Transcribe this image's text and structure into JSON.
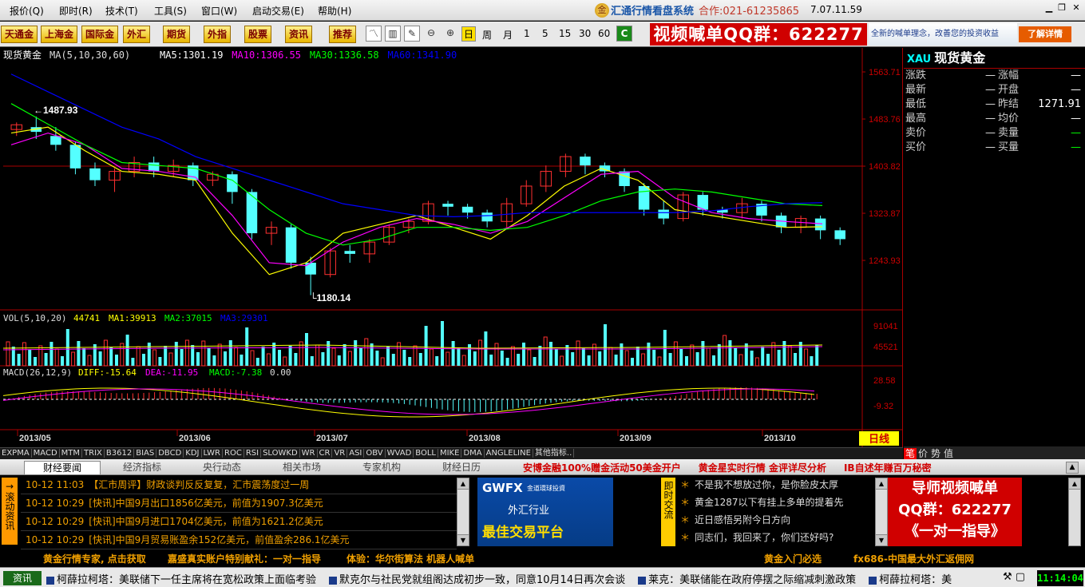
{
  "menu": {
    "items": [
      "报价(Q)",
      "即时(R)",
      "技术(T)",
      "工具(S)",
      "窗口(W)",
      "启动交易(E)",
      "帮助(H)"
    ],
    "app_name": "汇通行情看盘系统",
    "contact": "合作:021-61235865",
    "version": "7.07.11.59",
    "logo_char": "金"
  },
  "toolbar": {
    "market_buttons": [
      "天通金",
      "上海金",
      "国际金",
      "外汇",
      "期货",
      "外指",
      "股票",
      "资讯",
      "推荐"
    ],
    "periods": [
      "日",
      "周",
      "月",
      "1",
      "5",
      "15",
      "30",
      "60"
    ],
    "active_period": "日",
    "ad_banner": "视频喊单QQ群：622277",
    "ad_text": "全新的喊单理念，改善您的投资收益",
    "ad_button": "了解详情"
  },
  "main_chart": {
    "instrument": "现货黄金",
    "ma_label": "MA(5,10,30,60)",
    "ma_values": [
      {
        "name": "MA5",
        "value": "1301.19",
        "color": "#ffffff"
      },
      {
        "name": "MA10",
        "value": "1306.55",
        "color": "#ff00ff"
      },
      {
        "name": "MA30",
        "value": "1336.58",
        "color": "#00ff00"
      },
      {
        "name": "MA60",
        "value": "1341.90",
        "color": "#0000ff"
      }
    ],
    "y_ticks": [
      "1563.71",
      "1483.76",
      "1403.82",
      "1323.87",
      "1243.93"
    ],
    "high_marker": "1487.93",
    "low_marker": "1180.14"
  },
  "volume": {
    "label": "VOL(5,10,20)",
    "current": "44741",
    "ma1": "MA1:39913",
    "ma2": "MA2:37015",
    "ma3": "MA3:29301",
    "y_ticks": [
      "91041",
      "45521"
    ]
  },
  "macd": {
    "label": "MACD(26,12,9)",
    "diff": "DIFF:-15.64",
    "dea": "DEA:-11.95",
    "macd": "MACD:-7.38",
    "extra": "0.00",
    "y_ticks": [
      "28.58",
      "-9.32"
    ]
  },
  "x_axis": {
    "labels": [
      "2013/05",
      "2013/06",
      "2013/07",
      "2013/08",
      "2013/09",
      "2013/10"
    ],
    "mode": "日线"
  },
  "chart_data": {
    "type": "candlestick",
    "title": "现货黄金",
    "ylim": [
      1160,
      1580
    ],
    "x": [
      "2013/05",
      "2013/06",
      "2013/07",
      "2013/08",
      "2013/09",
      "2013/10"
    ],
    "annotations": [
      "1487.93",
      "1180.14"
    ],
    "series": [
      {
        "name": "MA5",
        "values": [
          1460,
          1470,
          1430,
          1395,
          1390,
          1380,
          1290,
          1220,
          1240,
          1290,
          1305,
          1320,
          1300,
          1280,
          1320,
          1370,
          1400,
          1380,
          1330,
          1320,
          1310,
          1300,
          1301
        ]
      },
      {
        "name": "MA10",
        "values": [
          1440,
          1460,
          1440,
          1400,
          1395,
          1385,
          1320,
          1240,
          1235,
          1275,
          1300,
          1315,
          1305,
          1290,
          1310,
          1350,
          1390,
          1395,
          1350,
          1325,
          1315,
          1310,
          1306
        ]
      },
      {
        "name": "MA30",
        "values": [
          1510,
          1475,
          1440,
          1410,
          1405,
          1400,
          1380,
          1330,
          1290,
          1270,
          1280,
          1300,
          1300,
          1295,
          1300,
          1320,
          1345,
          1360,
          1365,
          1360,
          1350,
          1340,
          1337
        ]
      },
      {
        "name": "MA60",
        "values": [
          1560,
          1530,
          1500,
          1470,
          1450,
          1420,
          1400,
          1380,
          1360,
          1340,
          1330,
          1320,
          1318,
          1320,
          1325,
          1325,
          1325,
          1325,
          1325,
          1328,
          1335,
          1340,
          1342
        ]
      }
    ],
    "candles": [
      [
        1466,
        1474,
        1455,
        1478
      ],
      [
        1470,
        1462,
        1450,
        1488
      ],
      [
        1455,
        1440,
        1430,
        1470
      ],
      [
        1440,
        1400,
        1390,
        1445
      ],
      [
        1400,
        1380,
        1370,
        1410
      ],
      [
        1380,
        1395,
        1360,
        1400
      ],
      [
        1395,
        1410,
        1385,
        1420
      ],
      [
        1410,
        1395,
        1385,
        1420
      ],
      [
        1395,
        1405,
        1385,
        1415
      ],
      [
        1405,
        1380,
        1370,
        1410
      ],
      [
        1380,
        1390,
        1370,
        1395
      ],
      [
        1390,
        1360,
        1340,
        1395
      ],
      [
        1360,
        1290,
        1280,
        1365
      ],
      [
        1290,
        1300,
        1270,
        1310
      ],
      [
        1300,
        1240,
        1230,
        1305
      ],
      [
        1240,
        1220,
        1185,
        1250
      ],
      [
        1220,
        1260,
        1215,
        1265
      ],
      [
        1260,
        1255,
        1240,
        1270
      ],
      [
        1255,
        1275,
        1240,
        1280
      ],
      [
        1275,
        1300,
        1270,
        1305
      ],
      [
        1300,
        1310,
        1290,
        1315
      ],
      [
        1310,
        1340,
        1305,
        1345
      ],
      [
        1340,
        1335,
        1320,
        1345
      ],
      [
        1335,
        1325,
        1315,
        1340
      ],
      [
        1325,
        1310,
        1300,
        1330
      ],
      [
        1310,
        1340,
        1300,
        1350
      ],
      [
        1340,
        1370,
        1335,
        1380
      ],
      [
        1370,
        1395,
        1360,
        1405
      ],
      [
        1395,
        1420,
        1385,
        1425
      ],
      [
        1420,
        1405,
        1390,
        1425
      ],
      [
        1405,
        1395,
        1385,
        1410
      ],
      [
        1395,
        1370,
        1360,
        1400
      ],
      [
        1370,
        1330,
        1320,
        1375
      ],
      [
        1330,
        1315,
        1305,
        1345
      ],
      [
        1315,
        1355,
        1310,
        1360
      ],
      [
        1355,
        1330,
        1320,
        1360
      ],
      [
        1330,
        1325,
        1315,
        1335
      ],
      [
        1325,
        1340,
        1315,
        1350
      ],
      [
        1340,
        1320,
        1310,
        1345
      ],
      [
        1320,
        1300,
        1290,
        1325
      ],
      [
        1300,
        1315,
        1290,
        1320
      ],
      [
        1315,
        1295,
        1280,
        1320
      ],
      [
        1295,
        1280,
        1270,
        1300
      ]
    ]
  },
  "quote_panel": {
    "code": "XAU",
    "name": "现货黄金",
    "rows": [
      {
        "l1": "涨跌",
        "v1": "—",
        "l2": "涨幅",
        "v2": "—",
        "v2_color": "white"
      },
      {
        "l1": "最新",
        "v1": "—",
        "l2": "开盘",
        "v2": "—",
        "v2_color": "white"
      },
      {
        "l1": "最低",
        "v1": "—",
        "l2": "昨结",
        "v2": "1271.91",
        "v2_color": "white"
      },
      {
        "l1": "最高",
        "v1": "—",
        "l2": "均价",
        "v2": "—",
        "v2_color": "white"
      },
      {
        "l1": "卖价",
        "v1": "—",
        "l2": "卖量",
        "v2": "—",
        "v2_color": "green"
      },
      {
        "l1": "买价",
        "v1": "—",
        "l2": "买量",
        "v2": "—",
        "v2_color": "green"
      }
    ],
    "tabs": [
      "笔",
      "价",
      "势",
      "值"
    ],
    "active_tab": "笔"
  },
  "indicators": [
    "EXPMA",
    "MACD",
    "MTM",
    "TRIX",
    "B3612",
    "BIAS",
    "DBCD",
    "KDJ",
    "LWR",
    "ROC",
    "RSI",
    "SLOWKD",
    "WR",
    "CR",
    "VR",
    "ASI",
    "OBV",
    "WVAD",
    "BOLL",
    "MIKE",
    "DMA",
    "ANGLELINE",
    "其他指标.."
  ],
  "news_tabs": [
    "财经要闻",
    "经济指标",
    "央行动态",
    "相关市场",
    "专家机构",
    "财经日历"
  ],
  "active_news_tab": "财经要闻",
  "promo_links": [
    "安博金融100%赠金活动50美金开户",
    "黄金星实时行情 金评详尽分析",
    "IB自述年赚百万秘密"
  ],
  "news_side_label": "滚动资讯",
  "news": [
    {
      "time": "10-12 11:03",
      "text": "【汇市周评】财政谈判反反复复，汇市震荡度过一周",
      "highlight": false
    },
    {
      "time": "10-12 10:29",
      "text": "[快讯]中国9月出口1856亿美元，前值为1907.3亿美元",
      "highlight": true
    },
    {
      "time": "10-12 10:29",
      "text": "[快讯]中国9月进口1704亿美元，前值为1621.2亿美元",
      "highlight": true
    },
    {
      "time": "10-12 10:29",
      "text": "[快讯]中国9月贸易账盈余152亿美元，前值盈余286.1亿美元",
      "highlight": true
    }
  ],
  "gwfx_ad": {
    "logo": "GWFX",
    "sub": "金道環球投資",
    "line1": "外汇行业",
    "line2": "最佳交易平台"
  },
  "live_label": "即时交流",
  "live_items": [
    "不是我不想放过你，是你脸皮太厚",
    "黄金1287以下有挂上多单的提着先",
    "近日感悟另附今日方向",
    "同志们，我回来了，你们还好吗?"
  ],
  "qq_ad": {
    "line1": "导师视频喊单",
    "line2": "QQ群：622277",
    "line3": "《一对一指导》"
  },
  "bottom_links": [
    "黄金行情专家, 点击获取",
    "嘉盛真实账户特别献礼：一对一指导",
    "体验：华尔街算法 机器人喊单",
    "黄金入门必选",
    "fx686-中国最大外汇返佣网"
  ],
  "ticker": {
    "logo": "资讯",
    "items": [
      "柯薛拉柯塔：美联储下一任主席将在宽松政策上面临考验",
      "默克尔与社民党就组阁达成初步一致，同意10月14日再次会谈",
      "莱克：美联储能在政府停摆之际缩减刺激政策",
      "柯薛拉柯塔：美"
    ],
    "clock": "11:14:04"
  }
}
